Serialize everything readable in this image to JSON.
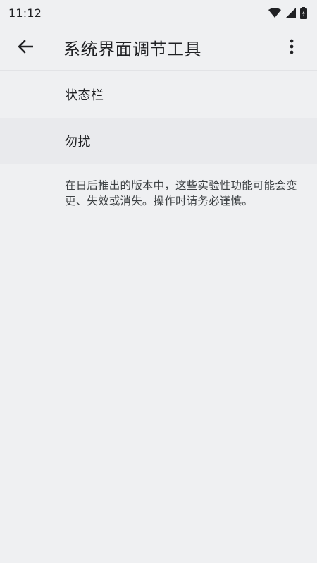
{
  "status_bar": {
    "time": "11:12",
    "icons": [
      "wifi-icon",
      "signal-icon",
      "battery-icon"
    ]
  },
  "app_bar": {
    "title": "系统界面调节工具",
    "back_icon": "arrow-back-icon",
    "overflow_icon": "more-vert-icon"
  },
  "list": {
    "items": [
      {
        "label": "状态栏"
      },
      {
        "label": "勿扰"
      }
    ]
  },
  "note": {
    "text": "在日后推出的版本中，这些实验性功能可能会变更、失效或消失。操作时请务必谨慎。"
  },
  "colors": {
    "background": "#eff0f2",
    "text_primary": "#202124",
    "text_secondary": "#3c4043"
  }
}
